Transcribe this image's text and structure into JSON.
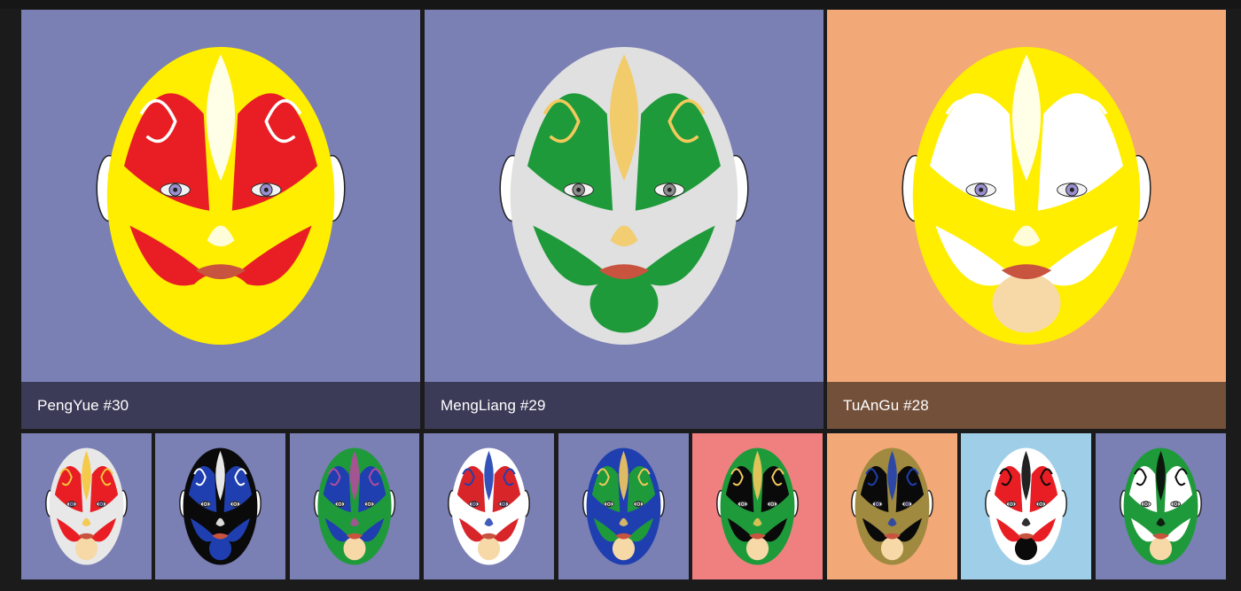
{
  "featured": [
    {
      "title": "PengYue #30",
      "bg": "#7a7fb4",
      "caption_bg": "#3b3b57",
      "mask": {
        "base": "#ffee00",
        "paint": "#e81e24",
        "accent": "#ffffff",
        "chin": "#ffee00",
        "eye": "#9b8fd0",
        "icon": "opera-mask-red-yellow-icon"
      }
    },
    {
      "title": "MengLiang #29",
      "bg": "#7a7fb4",
      "caption_bg": "#3b3b57",
      "mask": {
        "base": "#e0e0e0",
        "paint": "#1f9a3a",
        "accent": "#f4c95d",
        "chin": "#1f9a3a",
        "eye": "#8d8d8d",
        "icon": "opera-mask-green-white-icon"
      }
    },
    {
      "title": "TuAnGu #28",
      "bg": "#f3a878",
      "caption_bg": "#73503a",
      "mask": {
        "base": "#ffee00",
        "paint": "#ffffff",
        "accent": "#ffffff",
        "chin": "#f7d9a8",
        "eye": "#9b8fd0",
        "icon": "opera-mask-yellow-white-icon"
      }
    }
  ],
  "thumbnails": [
    {
      "bg": "#7a7fb4",
      "mask": {
        "base": "#e8e8e8",
        "paint": "#e81e24",
        "accent": "#f5c53b",
        "chin": "#f7d9a8",
        "eye": "#9b8fd0",
        "icon": "opera-mask-red-white-icon"
      }
    },
    {
      "bg": "#7a7fb4",
      "mask": {
        "base": "#0a0a0a",
        "paint": "#1f3fb0",
        "accent": "#ffffff",
        "chin": "#1f3fb0",
        "eye": "#d0d0d0",
        "icon": "opera-mask-black-blue-icon"
      }
    },
    {
      "bg": "#7a7fb4",
      "mask": {
        "base": "#1f9a3a",
        "paint": "#1f3fb0",
        "accent": "#b44c9c",
        "chin": "#f7d9a8",
        "eye": "#d0d0d0",
        "icon": "opera-mask-blue-green-icon"
      }
    },
    {
      "bg": "#7a7fb4",
      "mask": {
        "base": "#ffffff",
        "paint": "#d8252a",
        "accent": "#1f3fb0",
        "chin": "#f7d9a8",
        "eye": "#9b8fd0",
        "icon": "opera-mask-white-red-blue-icon"
      }
    },
    {
      "bg": "#7a7fb4",
      "mask": {
        "base": "#1f3fb0",
        "paint": "#1f9a3a",
        "accent": "#f4c95d",
        "chin": "#f7d9a8",
        "eye": "#d0d0d0",
        "icon": "opera-mask-blue-green-yellow-icon"
      }
    },
    {
      "bg": "#f08080",
      "mask": {
        "base": "#1f9a3a",
        "paint": "#0a0a0a",
        "accent": "#f4c95d",
        "chin": "#f7d9a8",
        "eye": "#d0d0d0",
        "icon": "opera-mask-green-black-icon"
      }
    },
    {
      "bg": "#f3a878",
      "mask": {
        "base": "#a08a40",
        "paint": "#0a0a0a",
        "accent": "#1f3fb0",
        "chin": "#f7d9a8",
        "eye": "#9b8fd0",
        "icon": "opera-mask-gold-black-icon"
      }
    },
    {
      "bg": "#9fcfe8",
      "mask": {
        "base": "#ffffff",
        "paint": "#e81e24",
        "accent": "#0a0a0a",
        "chin": "#0a0a0a",
        "eye": "#d0d0d0",
        "icon": "opera-mask-white-red-black-icon"
      }
    },
    {
      "bg": "#7a7fb4",
      "mask": {
        "base": "#1f9a3a",
        "paint": "#ffffff",
        "accent": "#0a0a0a",
        "chin": "#f7d9a8",
        "eye": "#d0d0d0",
        "icon": "opera-mask-green-white-black-icon"
      }
    }
  ]
}
